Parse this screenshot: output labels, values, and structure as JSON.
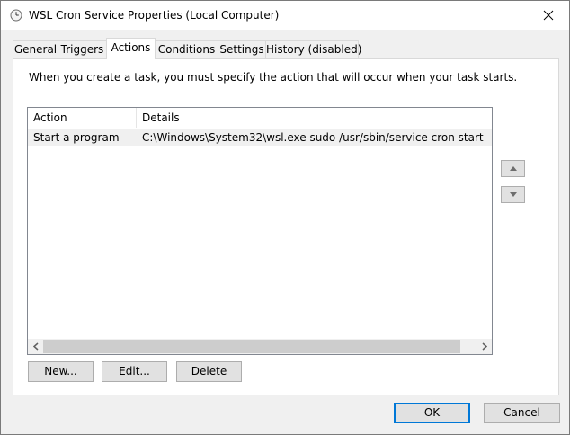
{
  "window": {
    "title": "WSL Cron Service Properties (Local Computer)"
  },
  "tabs": [
    {
      "label": "General"
    },
    {
      "label": "Triggers"
    },
    {
      "label": "Actions",
      "active": true
    },
    {
      "label": "Conditions"
    },
    {
      "label": "Settings"
    },
    {
      "label": "History (disabled)"
    }
  ],
  "actions_panel": {
    "description": "When you create a task, you must specify the action that will occur when your task starts.",
    "columns": [
      "Action",
      "Details"
    ],
    "rows": [
      {
        "action": "Start a program",
        "details": "C:\\Windows\\System32\\wsl.exe sudo /usr/sbin/service cron start"
      }
    ],
    "buttons": {
      "new": "New...",
      "edit": "Edit...",
      "delete": "Delete"
    }
  },
  "footer": {
    "ok": "OK",
    "cancel": "Cancel"
  },
  "colors": {
    "default_button_border": "#0078d7",
    "selected_row": "#f0f0f0"
  }
}
